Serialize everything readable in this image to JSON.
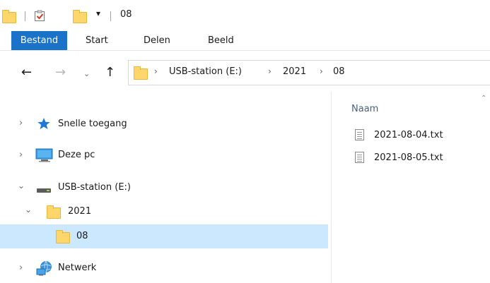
{
  "window": {
    "title": "08",
    "quick_access_dropdown": "▾"
  },
  "ribbon": {
    "tabs": [
      "Bestand",
      "Start",
      "Delen",
      "Beeld"
    ]
  },
  "address_bar": {
    "breadcrumbs": [
      "USB-station (E:)",
      "2021",
      "08"
    ]
  },
  "navigation_pane": {
    "items": [
      {
        "label": "Snelle toegang",
        "icon": "star-icon",
        "expanded": false
      },
      {
        "label": "Deze pc",
        "icon": "computer-icon",
        "expanded": false
      },
      {
        "label": "USB-station (E:)",
        "icon": "usb-drive-icon",
        "expanded": true
      },
      {
        "label": "2021",
        "icon": "folder-icon",
        "expanded": true
      },
      {
        "label": "08",
        "icon": "folder-icon",
        "selected": true
      },
      {
        "label": "Netwerk",
        "icon": "network-icon",
        "expanded": false
      }
    ]
  },
  "content": {
    "column_header": "Naam",
    "files": [
      {
        "name": "2021-08-04.txt",
        "icon": "text-file-icon"
      },
      {
        "name": "2021-08-05.txt",
        "icon": "text-file-icon"
      }
    ]
  },
  "colors": {
    "file_tab": "#1a73c8",
    "selection": "#cce8ff",
    "folder": "#ffd66b"
  }
}
